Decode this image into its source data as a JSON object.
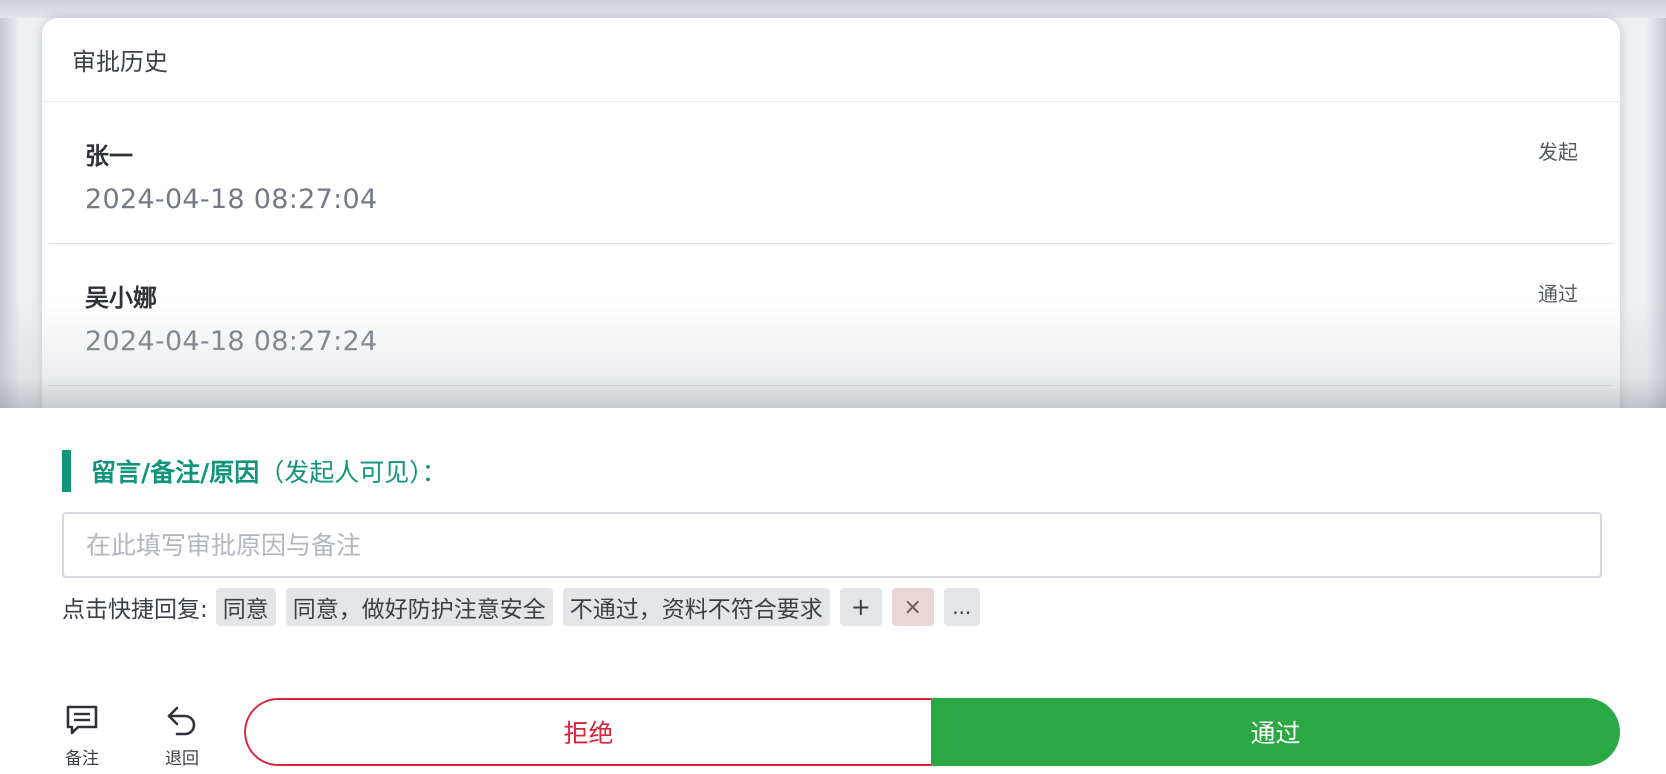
{
  "history": {
    "title": "审批历史",
    "items": [
      {
        "name": "张一",
        "time": "2024-04-18 08:27:04",
        "status": "发起"
      },
      {
        "name": "吴小娜",
        "time": "2024-04-18 08:27:24",
        "status": "通过"
      }
    ]
  },
  "remark": {
    "title_main": "留言/备注/原因",
    "title_sub": "（发起人可见）：",
    "placeholder": "在此填写审批原因与备注"
  },
  "quick_reply": {
    "label": "点击快捷回复:",
    "chips": [
      "同意",
      "同意，做好防护注意安全",
      "不通过，资料不符合要求"
    ],
    "add_label": "+",
    "delete_label": "×",
    "more_label": "..."
  },
  "toolbar": {
    "note_label": "备注",
    "note_icon": "comment-icon",
    "back_label": "退回",
    "back_icon": "undo-icon"
  },
  "actions": {
    "reject_label": "拒绝",
    "approve_label": "通过"
  },
  "colors": {
    "accent": "#10957b",
    "reject": "#d8233a",
    "approve": "#29a843"
  }
}
